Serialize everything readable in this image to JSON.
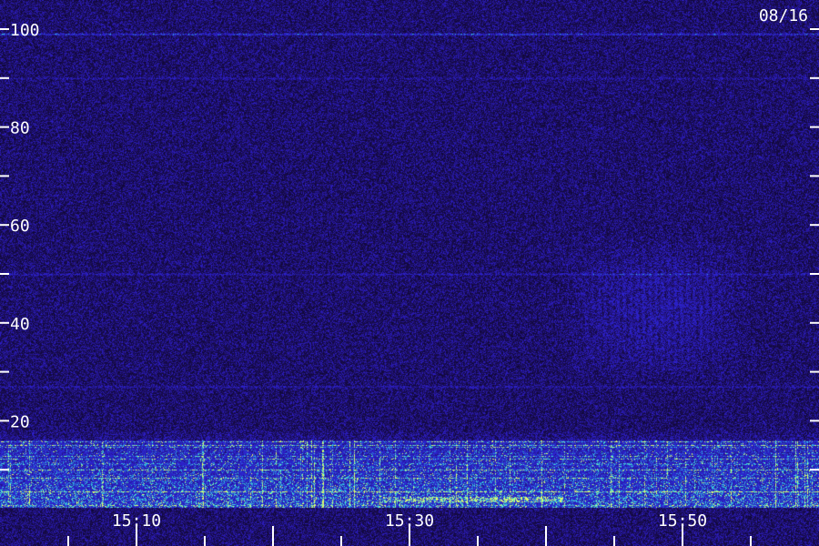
{
  "chart_data": {
    "type": "heatmap",
    "date_label": "08/16",
    "y_axis": {
      "ylim": [
        0,
        100
      ],
      "major_ticks": [
        20,
        40,
        60,
        80,
        100
      ],
      "major_tick_labels": [
        "20",
        "40",
        "60",
        "80",
        "100"
      ],
      "minor_ticks": [
        10,
        30,
        50,
        70,
        90
      ]
    },
    "x_axis": {
      "xlim": [
        "15:00",
        "16:00"
      ],
      "tick_labels": [
        "15:10",
        "15:30",
        "15:50"
      ],
      "label_positions": [
        "15:10",
        "15:30",
        "15:50"
      ],
      "major_ticks": [
        "15:10",
        "15:20",
        "15:30",
        "15:40",
        "15:50"
      ],
      "minor_ticks": [
        "15:05",
        "15:15",
        "15:25",
        "15:35",
        "15:45",
        "15:55"
      ]
    },
    "intensity_features": [
      {
        "kind": "horizontal_line",
        "y": 99,
        "strength": 0.85
      },
      {
        "kind": "horizontal_line",
        "y": 90,
        "strength": 0.35
      },
      {
        "kind": "horizontal_line",
        "y": 50,
        "strength": 0.45
      },
      {
        "kind": "horizontal_line",
        "y": 27,
        "strength": 0.4
      },
      {
        "kind": "low_band",
        "y_range": [
          3,
          16
        ],
        "strength": 1.0
      },
      {
        "kind": "diffuse_patch",
        "x_range": [
          "15:41",
          "15:55"
        ],
        "y_range": [
          28,
          58
        ],
        "strength": 0.55
      }
    ],
    "colors": {
      "background": "#1a0d52",
      "mid": "#2a2ad0",
      "high": "#33e0e0",
      "peak": "#e6ff66",
      "axis": "#ffffff"
    }
  }
}
